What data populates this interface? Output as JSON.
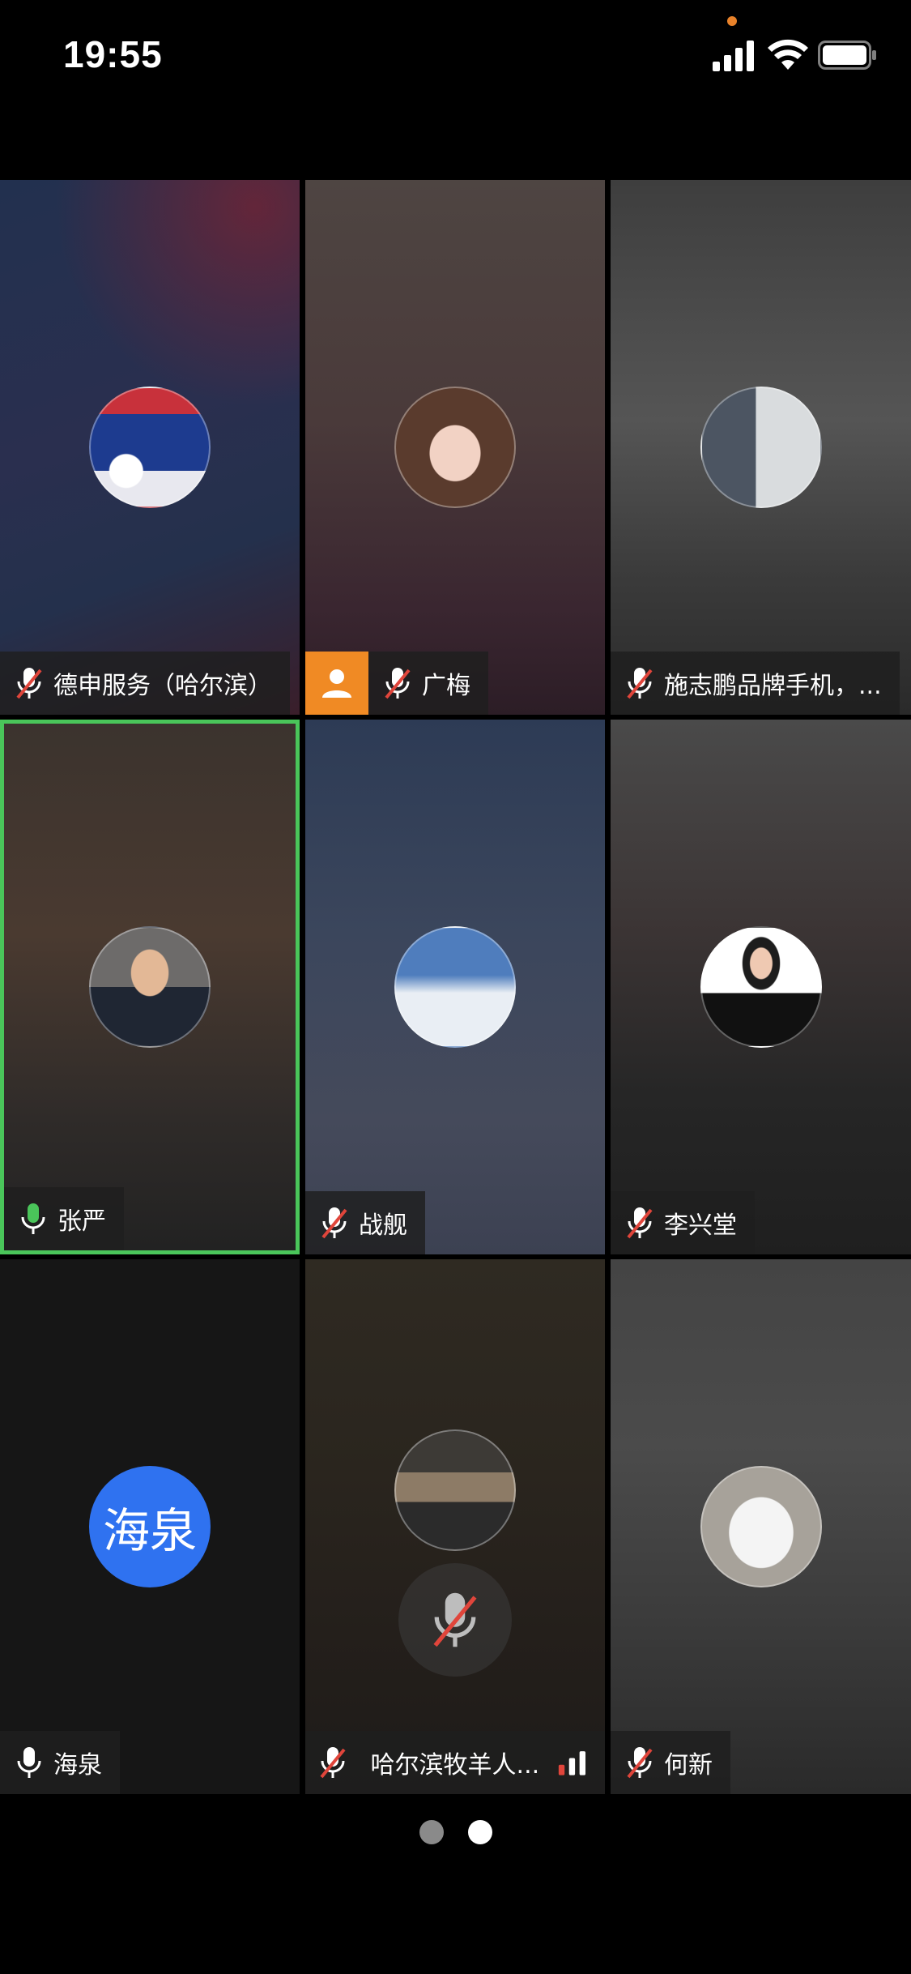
{
  "status_bar": {
    "time": "19:55"
  },
  "participants": [
    {
      "name": "德申服务（哈尔滨）",
      "muted": true
    },
    {
      "name": "广梅",
      "muted": true,
      "camera_off_badge": true
    },
    {
      "name": "施志鹏品牌手机，...",
      "muted": true
    },
    {
      "name": "张严",
      "muted": false,
      "speaking": true
    },
    {
      "name": "战舰",
      "muted": true
    },
    {
      "name": "李兴堂",
      "muted": true
    },
    {
      "name": "海泉",
      "muted": false,
      "avatar_text": "海泉"
    },
    {
      "name": "哈尔滨牧羊人...",
      "muted": true,
      "network_indicator": true
    },
    {
      "name": "何新",
      "muted": true
    }
  ],
  "pager": {
    "pages": 2,
    "current": 2
  },
  "colors": {
    "active_border": "#4ac55a",
    "camera_badge": "#f08a24",
    "letter_avatar": "#2f72f0"
  }
}
